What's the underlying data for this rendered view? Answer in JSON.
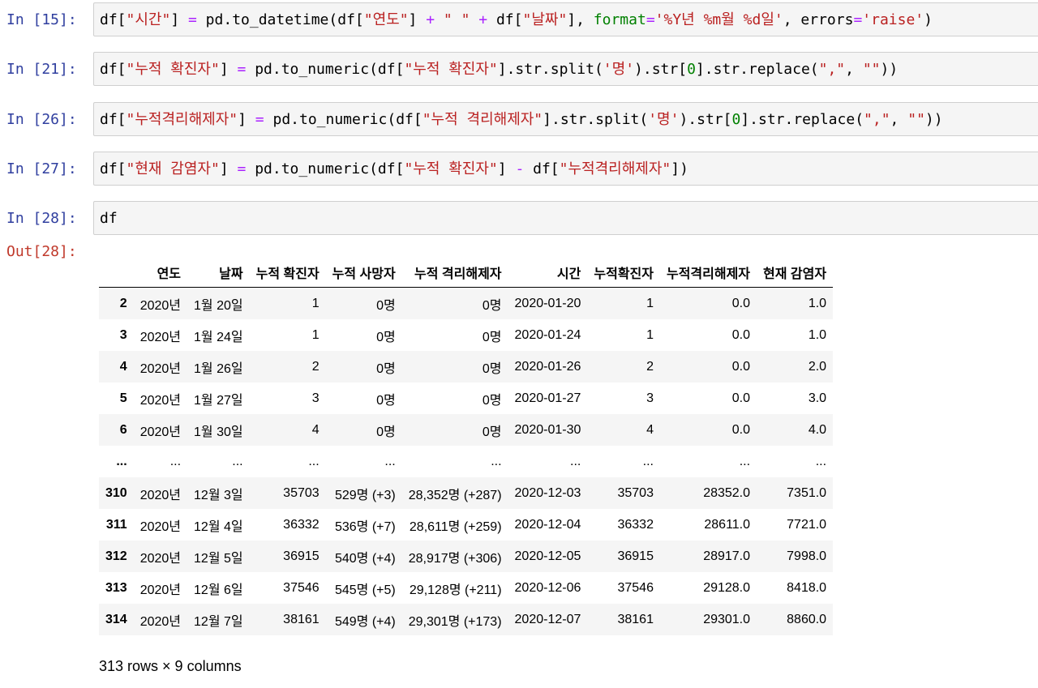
{
  "cells": [
    {
      "prompt": "In [15]:",
      "code_parts": [
        [
          "",
          "df["
        ],
        [
          "s",
          "\"시간\""
        ],
        [
          "",
          "] "
        ],
        [
          "o",
          "="
        ],
        [
          "",
          " pd.to_datetime("
        ],
        [
          "",
          "df["
        ],
        [
          "s",
          "\"연도\""
        ],
        [
          "",
          "] "
        ],
        [
          "o",
          "+"
        ],
        [
          "",
          " "
        ],
        [
          "s",
          "\" \""
        ],
        [
          "",
          " "
        ],
        [
          "o",
          "+"
        ],
        [
          "",
          " df["
        ],
        [
          "s",
          "\"날짜\""
        ],
        [
          "",
          "], "
        ],
        [
          "n",
          "format"
        ],
        [
          "o",
          "="
        ],
        [
          "s",
          "'%Y년 %m월 %d일'"
        ],
        [
          "",
          ", errors"
        ],
        [
          "o",
          "="
        ],
        [
          "s",
          "'raise'"
        ],
        [
          "",
          ")"
        ]
      ]
    },
    {
      "prompt": "In [21]:",
      "code_parts": [
        [
          "",
          "df["
        ],
        [
          "s",
          "\"누적 확진자\""
        ],
        [
          "",
          "] "
        ],
        [
          "o",
          "="
        ],
        [
          "",
          " pd.to_numeric(df["
        ],
        [
          "s",
          "\"누적 확진자\""
        ],
        [
          "",
          "].str.split("
        ],
        [
          "s",
          "'명'"
        ],
        [
          "",
          ").str["
        ],
        [
          "n",
          "0"
        ],
        [
          "",
          "].str.replace("
        ],
        [
          "s",
          "\",\""
        ],
        [
          "",
          ", "
        ],
        [
          "s",
          "\"\""
        ],
        [
          "",
          "))"
        ]
      ]
    },
    {
      "prompt": "In [26]:",
      "code_parts": [
        [
          "",
          "df["
        ],
        [
          "s",
          "\"누적격리해제자\""
        ],
        [
          "",
          "] "
        ],
        [
          "o",
          "="
        ],
        [
          "",
          " pd.to_numeric(df["
        ],
        [
          "s",
          "\"누적 격리해제자\""
        ],
        [
          "",
          "].str.split("
        ],
        [
          "s",
          "'명'"
        ],
        [
          "",
          ").str["
        ],
        [
          "n",
          "0"
        ],
        [
          "",
          "].str.replace("
        ],
        [
          "s",
          "\",\""
        ],
        [
          "",
          ", "
        ],
        [
          "s",
          "\"\""
        ],
        [
          "",
          "))"
        ]
      ]
    },
    {
      "prompt": "In [27]:",
      "code_parts": [
        [
          "",
          "df["
        ],
        [
          "s",
          "\"현재 감염자\""
        ],
        [
          "",
          "] "
        ],
        [
          "o",
          "="
        ],
        [
          "",
          " pd.to_numeric(df["
        ],
        [
          "s",
          "\"누적 확진자\""
        ],
        [
          "",
          "] "
        ],
        [
          "o",
          "-"
        ],
        [
          "",
          " df["
        ],
        [
          "s",
          "\"누적격리해제자\""
        ],
        [
          "",
          "])"
        ]
      ]
    },
    {
      "prompt": "In [28]:",
      "code_parts": [
        [
          "",
          "df"
        ]
      ]
    }
  ],
  "output": {
    "prompt": "Out[28]:",
    "columns": [
      "연도",
      "날짜",
      "누적 확진자",
      "누적 사망자",
      "누적 격리해제자",
      "시간",
      "누적확진자",
      "누적격리해제자",
      "현재 감염자"
    ],
    "rows": [
      [
        "2",
        "2020년",
        "1월 20일",
        "1",
        "0명",
        "0명",
        "2020-01-20",
        "1",
        "0.0",
        "1.0"
      ],
      [
        "3",
        "2020년",
        "1월 24일",
        "1",
        "0명",
        "0명",
        "2020-01-24",
        "1",
        "0.0",
        "1.0"
      ],
      [
        "4",
        "2020년",
        "1월 26일",
        "2",
        "0명",
        "0명",
        "2020-01-26",
        "2",
        "0.0",
        "2.0"
      ],
      [
        "5",
        "2020년",
        "1월 27일",
        "3",
        "0명",
        "0명",
        "2020-01-27",
        "3",
        "0.0",
        "3.0"
      ],
      [
        "6",
        "2020년",
        "1월 30일",
        "4",
        "0명",
        "0명",
        "2020-01-30",
        "4",
        "0.0",
        "4.0"
      ],
      [
        "...",
        "...",
        "...",
        "...",
        "...",
        "...",
        "...",
        "...",
        "...",
        "..."
      ],
      [
        "310",
        "2020년",
        "12월 3일",
        "35703",
        "529명 (+3)",
        "28,352명 (+287)",
        "2020-12-03",
        "35703",
        "28352.0",
        "7351.0"
      ],
      [
        "311",
        "2020년",
        "12월 4일",
        "36332",
        "536명 (+7)",
        "28,611명 (+259)",
        "2020-12-04",
        "36332",
        "28611.0",
        "7721.0"
      ],
      [
        "312",
        "2020년",
        "12월 5일",
        "36915",
        "540명 (+4)",
        "28,917명 (+306)",
        "2020-12-05",
        "36915",
        "28917.0",
        "7998.0"
      ],
      [
        "313",
        "2020년",
        "12월 6일",
        "37546",
        "545명 (+5)",
        "29,128명 (+211)",
        "2020-12-06",
        "37546",
        "29128.0",
        "8418.0"
      ],
      [
        "314",
        "2020년",
        "12월 7일",
        "38161",
        "549명 (+4)",
        "29,301명 (+173)",
        "2020-12-07",
        "38161",
        "29301.0",
        "8860.0"
      ]
    ],
    "summary": "313 rows × 9 columns"
  }
}
